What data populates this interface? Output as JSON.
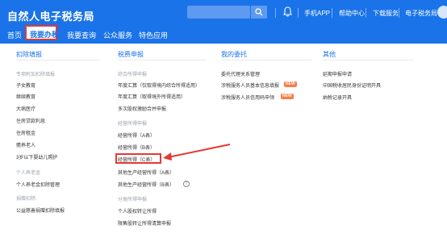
{
  "header": {
    "brand": "自然人电子税务局",
    "links": [
      "手机APP",
      "帮助中心",
      "下载服务",
      "电子税务局"
    ]
  },
  "nav": {
    "items": [
      "首页",
      "我要办税",
      "我要查询",
      "公众服务",
      "特色应用"
    ],
    "active_index": 1
  },
  "columns": [
    {
      "title": "扣除填报"
    },
    {
      "title": "税费申报"
    },
    {
      "title": "我的委托"
    },
    {
      "title": "其他"
    }
  ],
  "col1": {
    "group1": "专项附加扣除填报",
    "items": [
      "子女教育",
      "继续教育",
      "大病医疗",
      "住房贷款利息",
      "住房租金",
      "赡养老人",
      "3岁以下婴幼儿照护"
    ],
    "group2": "个人养老金",
    "item_pension": "个人养老金扣除管理",
    "group3": "捐赠扣除",
    "item_donation": "公益慈善捐赠扣除填报"
  },
  "col2": {
    "group1": "综合所得申报",
    "items1": [
      "年度汇算（仅取得境内综合所得适用）",
      "年度汇算（取得境外所得适用）",
      "多次股权激励合并申报"
    ],
    "group2": "经营所得申报",
    "items2": [
      "经营所得（A表）",
      "经营所得（B表）",
      "经营所得（C表）",
      "其他生产经营所得（A表）",
      "其他生产经营所得（B表）"
    ],
    "group3": "分类所得申报",
    "items3": [
      "个人股权转让所得",
      "限售股转让所得清算申报"
    ]
  },
  "col3": {
    "items": [
      "委托代理关系管理",
      "涉税服务人员基本信息填报",
      "涉税服务人员信用码申领"
    ],
    "badge": "NEW"
  },
  "col4": {
    "items": [
      "延期申报申请",
      "中国税收居民身份证明开具",
      "纳税记录开具"
    ]
  },
  "help_icon": "?"
}
